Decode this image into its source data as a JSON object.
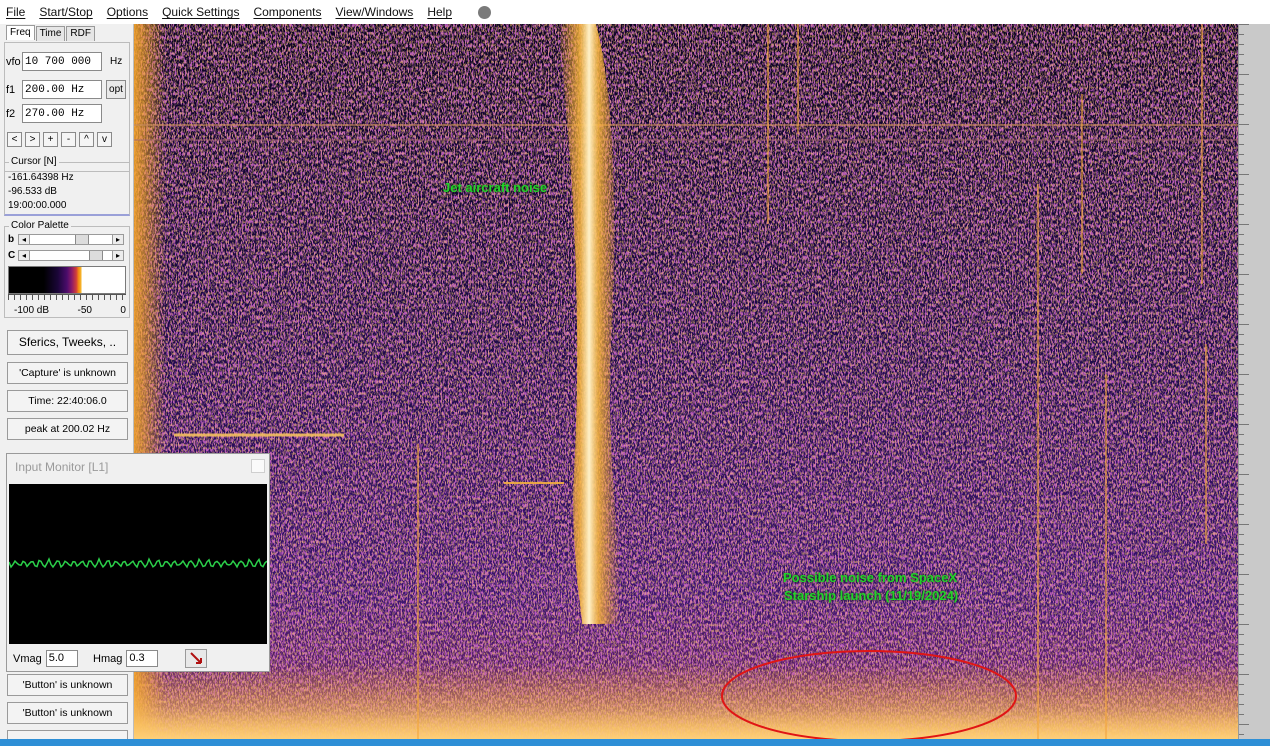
{
  "menu": [
    "File",
    "Start/Stop",
    "Options",
    "Quick Settings",
    "Components",
    "View/Windows",
    "Help"
  ],
  "tabs": [
    "Freq",
    "Time",
    "RDF"
  ],
  "freq": {
    "vfo_label": "vfo",
    "vfo_value": "10 700 000",
    "vfo_unit": "Hz",
    "f1_label": "f1",
    "f1_value": "200.00 Hz",
    "opt_label": "opt",
    "f2_label": "f2",
    "f2_value": "270.00 Hz"
  },
  "nav_buttons": [
    "<",
    ">",
    "+",
    "-",
    "^",
    "v"
  ],
  "cursor": {
    "title": "Cursor [N]",
    "freq": "-161.64398 Hz",
    "level": "-96.533 dB",
    "time": "19:00:00.000"
  },
  "palette": {
    "title": "Color Palette",
    "b_label": "b",
    "c_label": "C",
    "scale": [
      "-100 dB",
      "-50",
      "0"
    ]
  },
  "side_buttons": {
    "sferics": "Sferics, Tweeks, ..",
    "capture": "'Capture' is unknown",
    "time": "Time:  22:40:06.0",
    "peak": "peak at 200.02 Hz",
    "button1": "'Button' is unknown",
    "button2": "'Button' is unknown"
  },
  "monitor": {
    "title": "Input Monitor [L1]",
    "vmag_label": "Vmag",
    "vmag_value": "5.0",
    "hmag_label": "Hmag",
    "hmag_value": "0.3"
  },
  "annotations": {
    "jet": "Jet aircraft noise",
    "spacex_line1": "Possible noise from SpaceX",
    "spacex_line2": "Starship launch (11/19/2024)"
  },
  "colors": {
    "annotation": "#22d32a",
    "ellipse": "#e01515",
    "taskbar": "#2e8fd6"
  },
  "icons": [
    "menu-status-dot-icon",
    "probe-cursor-icon",
    "close-icon"
  ]
}
